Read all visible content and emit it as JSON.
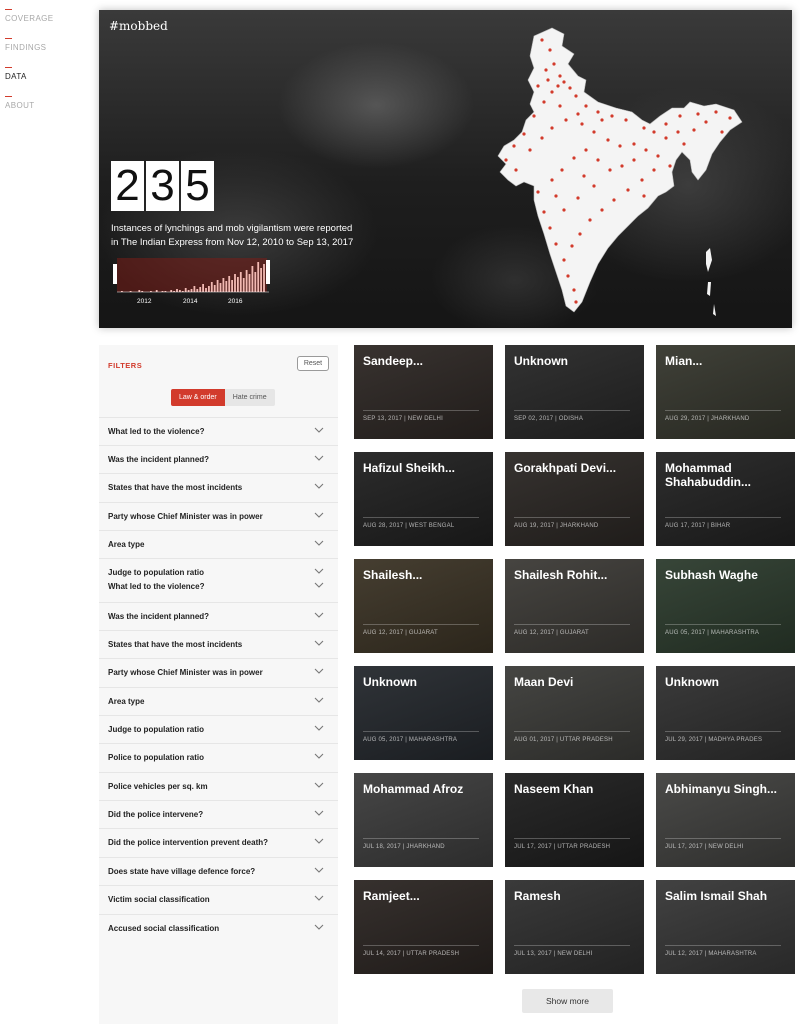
{
  "nav": {
    "items": [
      {
        "label": "COVERAGE"
      },
      {
        "label": "FINDINGS"
      },
      {
        "label": "DATA"
      },
      {
        "label": "ABOUT"
      }
    ]
  },
  "hero": {
    "tag": "#mobbed",
    "count_digits": [
      "2",
      "3",
      "5"
    ],
    "description": "Instances of lynchings and mob vigilantism were reported in The Indian Express from Nov 12, 2010 to Sep 13, 2017",
    "timeline_labels": [
      "2012",
      "2014",
      "2016"
    ]
  },
  "filters": {
    "heading": "FILTERS",
    "reset_label": "Reset",
    "toggle": {
      "active": "Law & order",
      "inactive": "Hate crime"
    },
    "rows": [
      "What led to the violence?",
      "Was the incident planned?",
      "States that have the most incidents",
      "Party whose Chief Minister was in power",
      "Area type",
      "Judge to population ratio",
      "What led to the violence?",
      "Was the incident planned?",
      "States that have the most incidents",
      "Party whose Chief Minister was in power",
      "Area type",
      "Judge to population ratio",
      "Police to population ratio",
      "Police vehicles per sq. km",
      "Did the police intervene?",
      "Did the police intervention prevent death?",
      "Does state have village defence force?",
      "Victim social classification",
      "Accused social classification"
    ]
  },
  "cards": [
    {
      "name": "Sandeep...",
      "meta": "SEP 13, 2017 | NEW DELHI",
      "bg": "#2c2623"
    },
    {
      "name": "Unknown",
      "meta": "SEP 02, 2017 | ODISHA",
      "bg": "#262626"
    },
    {
      "name": "Mian...",
      "meta": "AUG 29, 2017 | JHARKHAND",
      "bg": "#34352c"
    },
    {
      "name": "Hafizul Sheikh...",
      "meta": "AUG 28, 2017 | WEST BENGAL",
      "bg": "#1f1f1f"
    },
    {
      "name": "Gorakhpati Devi...",
      "meta": "AUG 19, 2017 | JHARKHAND",
      "bg": "#2a2623"
    },
    {
      "name": "Mohammad Shahabuddin...",
      "meta": "AUG 17, 2017 | BIHAR",
      "bg": "#212121"
    },
    {
      "name": "Shailesh...",
      "meta": "AUG 12, 2017 | GUJARAT",
      "bg": "#3a3224"
    },
    {
      "name": "Shailesh Rohit...",
      "meta": "AUG 12, 2017 | GUJARAT",
      "bg": "#3b3935"
    },
    {
      "name": "Subhash Waghe",
      "meta": "AUG 05, 2017 | MAHARASHTRA",
      "bg": "#2b3a2c"
    },
    {
      "name": "Unknown",
      "meta": "AUG 05, 2017 | MAHARASHTRA",
      "bg": "#23272c"
    },
    {
      "name": "Maan Devi",
      "meta": "AUG 01, 2017 | UTTAR PRADESH",
      "bg": "#3a3a37"
    },
    {
      "name": "Unknown",
      "meta": "JUL 29, 2017 | MADHYA PRADES",
      "bg": "#2f2f2f"
    },
    {
      "name": "Mohammad Afroz",
      "meta": "JUL 18, 2017 | JHARKHAND",
      "bg": "#3b3b3b"
    },
    {
      "name": "Naseem Khan",
      "meta": "JUL 17, 2017 | UTTAR PRADESH",
      "bg": "#1d1d1d"
    },
    {
      "name": "Abhimanyu Singh...",
      "meta": "JUL 17, 2017 | NEW DELHI",
      "bg": "#3f3f3d"
    },
    {
      "name": "Ramjeet...",
      "meta": "JUL 14, 2017 | UTTAR PRADESH",
      "bg": "#2a2421"
    },
    {
      "name": "Ramesh",
      "meta": "JUL 13, 2017 | NEW DELHI",
      "bg": "#2e2e2e"
    },
    {
      "name": "Salim Ismail Shah",
      "meta": "JUL 12, 2017 | MAHARASHTRA",
      "bg": "#363636"
    }
  ],
  "show_more_label": "Show more",
  "colors": {
    "accent": "#d23b2c"
  }
}
